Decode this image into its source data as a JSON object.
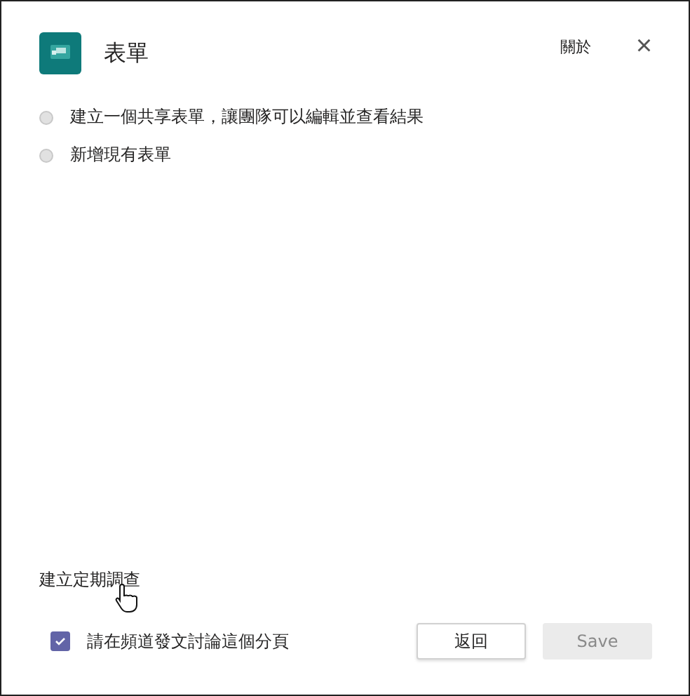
{
  "dialog": {
    "title": "表單",
    "about_link": "關於",
    "close": "×"
  },
  "options": [
    {
      "label": "建立一個共享表單，讓團隊可以編輯並查看結果",
      "selected": false
    },
    {
      "label": "新增現有表單",
      "selected": false
    }
  ],
  "survey_link": "建立定期調查",
  "post_checkbox": {
    "label": "請在頻道發文討論這個分頁",
    "checked": true
  },
  "buttons": [
    {
      "label": "返回",
      "disabled": false
    },
    {
      "label": "Save",
      "disabled": true
    }
  ]
}
